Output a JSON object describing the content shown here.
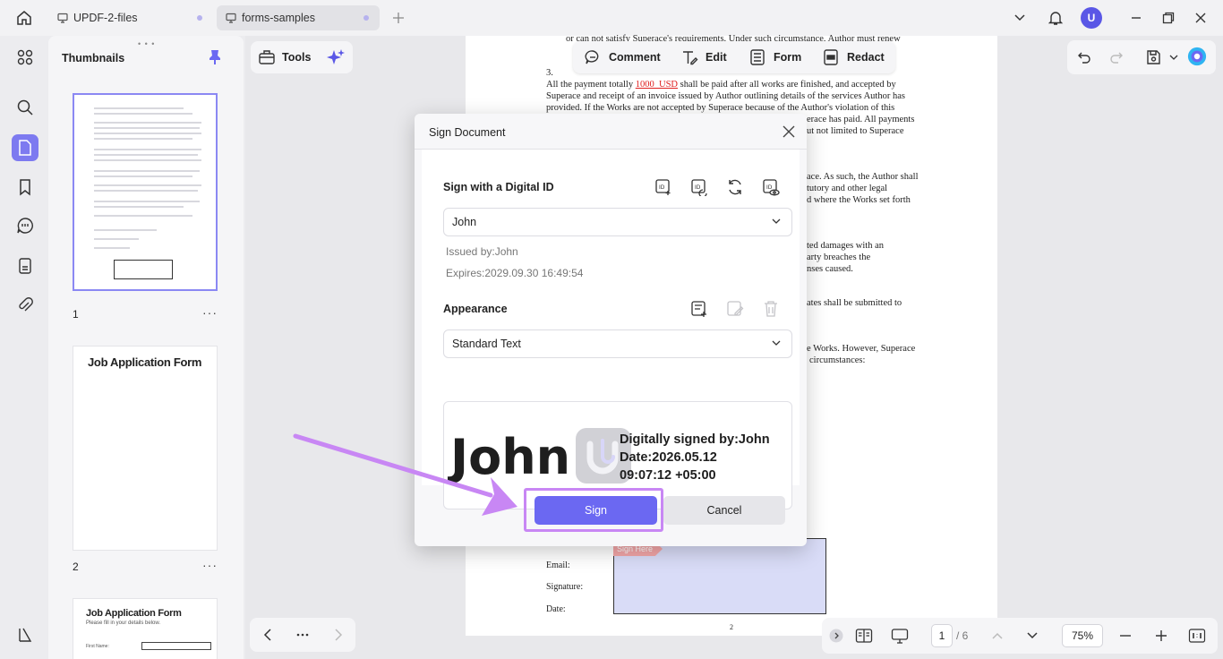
{
  "tabs": [
    {
      "label": "UPDF-2-files"
    },
    {
      "label": "forms-samples"
    }
  ],
  "user": {
    "initial": "U"
  },
  "thumbnails": {
    "title": "Thumbnails",
    "pages": [
      {
        "number": "1",
        "more": "···"
      },
      {
        "number": "2",
        "more": "···",
        "title": "Job Application Form"
      },
      {
        "title": "Job Application Form",
        "subtitle": "Please fill in your details below.",
        "field": "First Name:"
      }
    ]
  },
  "toolbar": {
    "tools_label": "Tools",
    "comment_label": "Comment",
    "edit_label": "Edit",
    "form_label": "Form",
    "redact_label": "Redact"
  },
  "document": {
    "lines_top": [
      "or can not satisfy Superace's requirements. Under such circumstance, Author must renew"
    ],
    "section_number": "3.",
    "para_pre": "All the payment totally ",
    "para_amount": "1000_USD",
    "para_post": " shall be paid after all works are finished, and accepted by",
    "para_lines": [
      "Superace and receipt of an invoice issued by Author outlining details of the services Author has",
      "provided. If the Works are not accepted by Superace because of the Author's violation of this",
      "erace has paid. All payments",
      "ut not limited to Superace"
    ],
    "right_fragments": [
      "ace. As such, the Author shall",
      "tutory and other legal",
      "d where the Works set forth",
      "ted damages with an",
      "arty breaches the",
      "nses caused.",
      "ates shall be submitted to",
      "e Works. However, Superace",
      "circumstances:"
    ],
    "email_label": "Email:",
    "signature_label": "Signature:",
    "date_label": "Date:",
    "sign_here": "Sign Here",
    "page_number": "2"
  },
  "dialog": {
    "title": "Sign Document",
    "digital_id_title": "Sign with a Digital ID",
    "selected_id": "John",
    "issued_by": "Issued by:John",
    "expires": "Expires:2029.09.30 16:49:54",
    "appearance_title": "Appearance",
    "selected_appearance": "Standard Text",
    "preview": {
      "name": "John",
      "line1": "Digitally signed by:John",
      "line2": "Date:2026.05.12",
      "line3": "09:07:12 +05:00"
    },
    "sign_label": "Sign",
    "cancel_label": "Cancel"
  },
  "pager": {
    "current": "1",
    "total": "/ 6",
    "zoom": "75%"
  },
  "colors": {
    "accent": "#6b68f2",
    "highlight": "#c887f4",
    "amount": "#e02020"
  }
}
